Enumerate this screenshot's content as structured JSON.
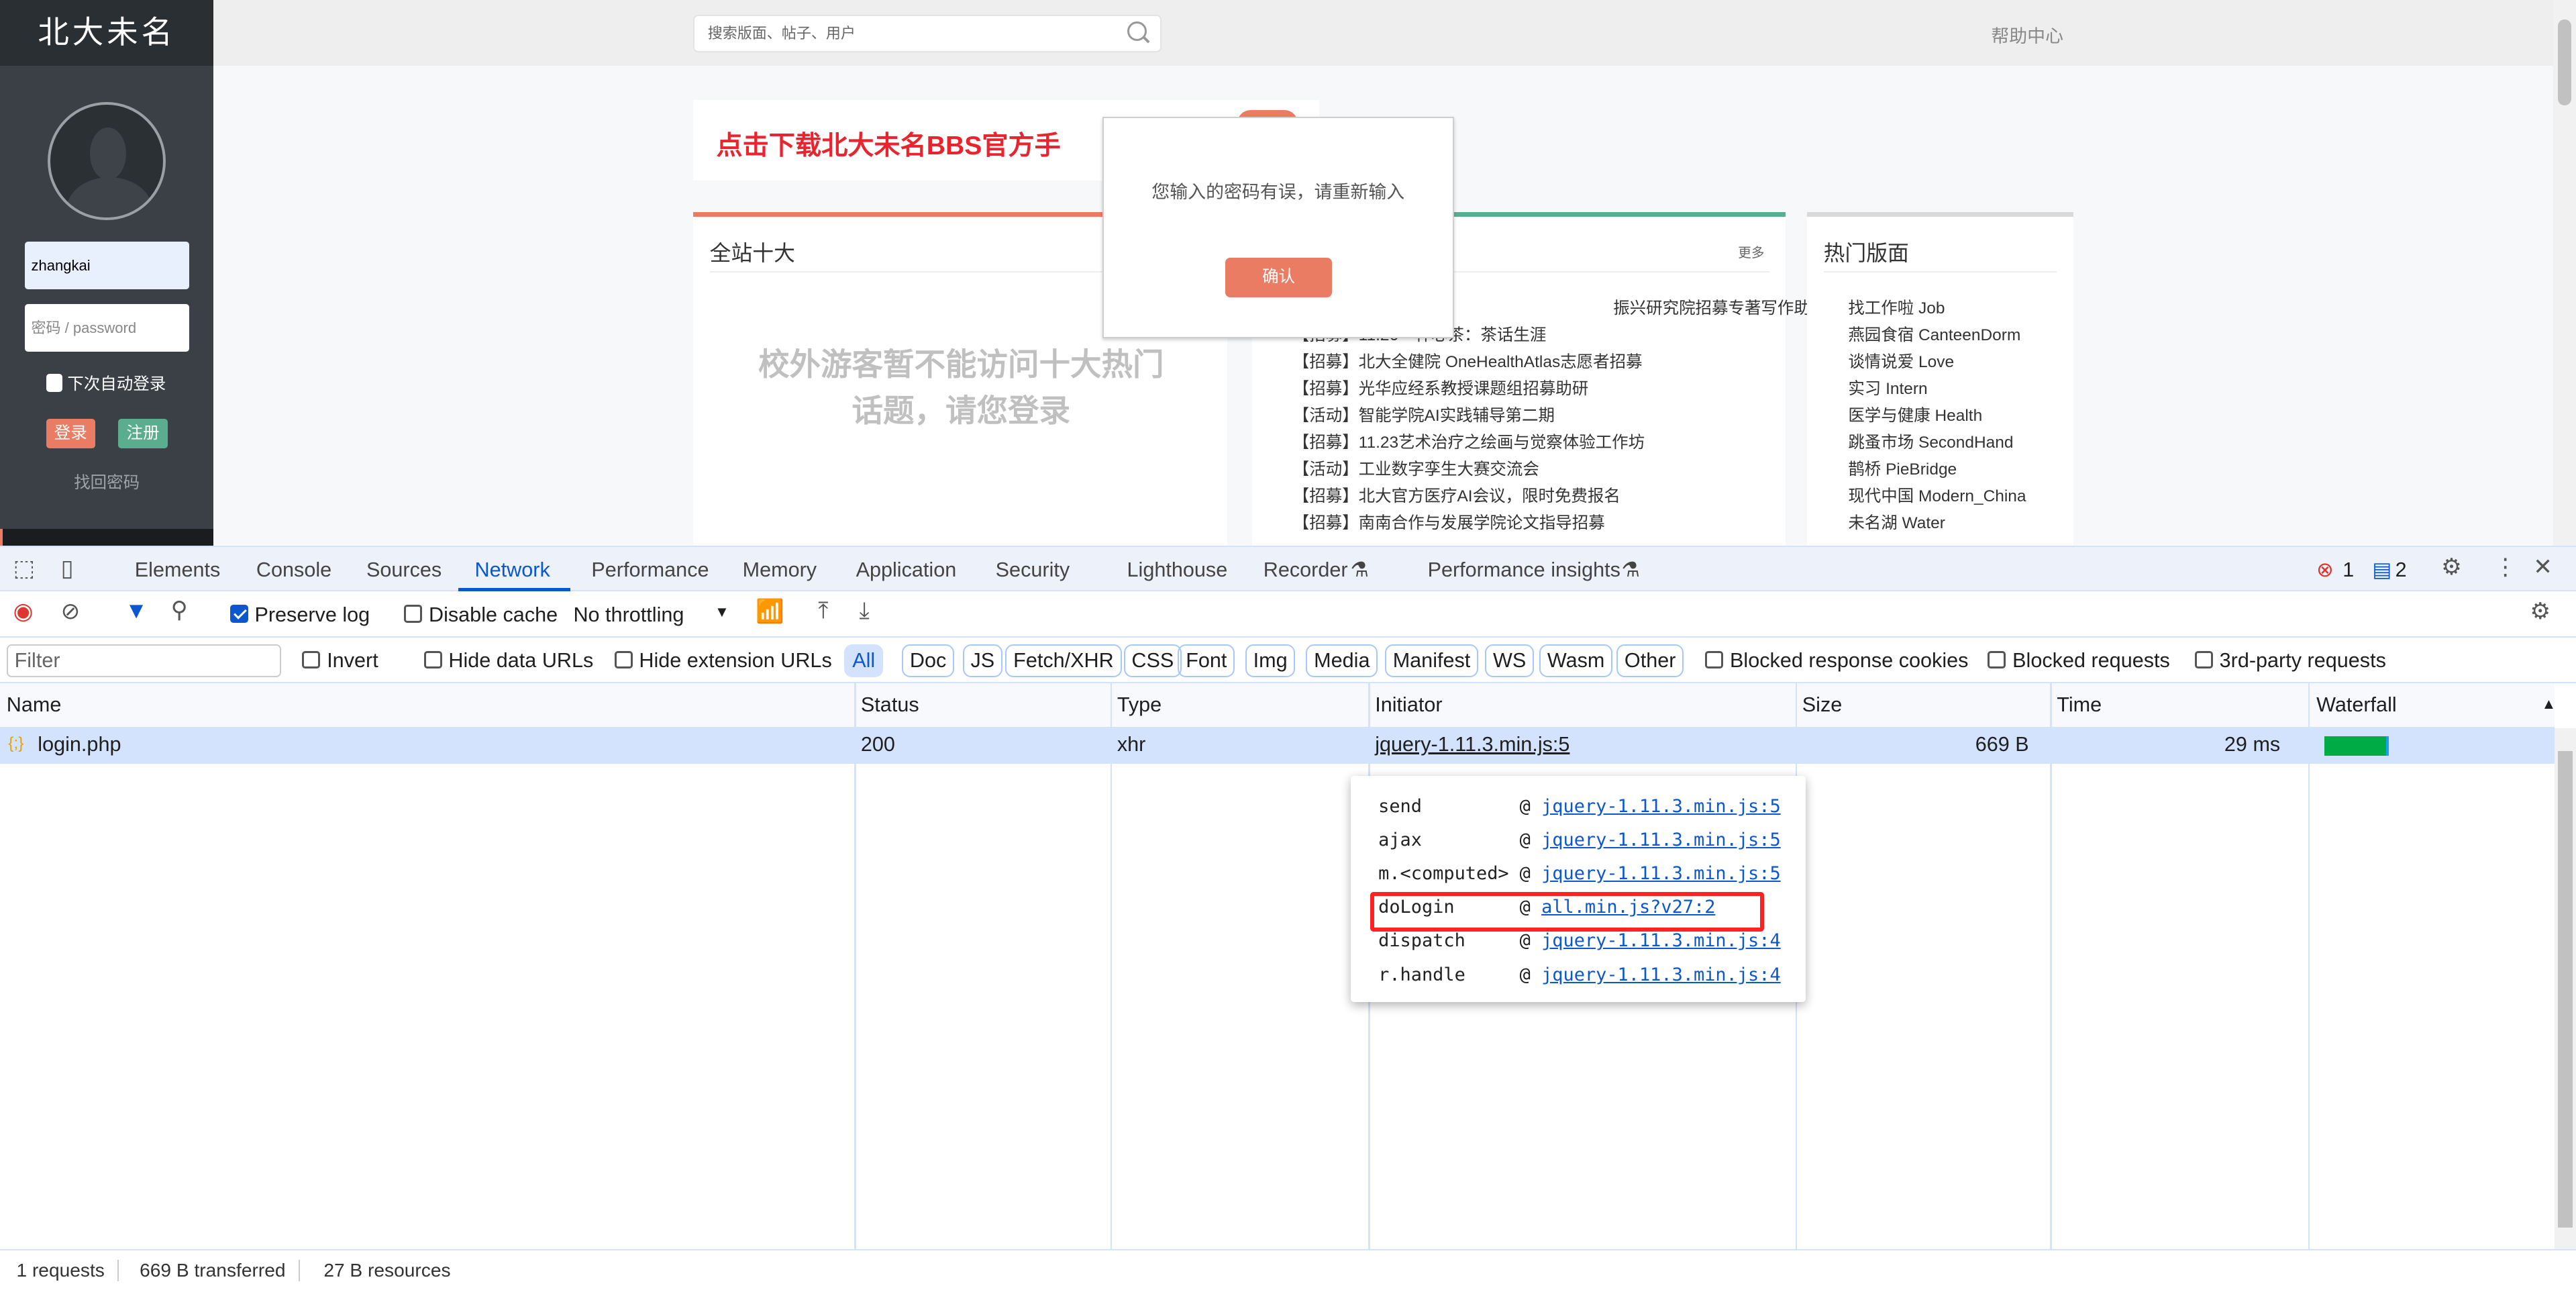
{
  "site": {
    "logo": "北大未名",
    "search_placeholder": "搜索版面、帖子、用户",
    "help": "帮助中心",
    "banner": "点击下载北大未名BBS官方手",
    "login": {
      "username": "zhangkai",
      "password_placeholder": "密码 / password",
      "auto_login": "下次自动登录",
      "login_btn": "登录",
      "register_btn": "注册",
      "forgot": "找回密码"
    },
    "top_ten": {
      "title": "全站十大",
      "guest_msg_1": "校外游客暂不能访问十大热门",
      "guest_msg_2": "话题，请您登录"
    },
    "news": {
      "more": "更多",
      "items": [
        "振兴研究院招募专著写作助研",
        "【招募】11.26一杯心茶：茶话生涯",
        "【招募】北大全健院 OneHealthAtlas志愿者招募",
        "【招募】光华应经系教授课题组招募助研",
        "【活动】智能学院AI实践辅导第二期",
        "【招募】11.23艺术治疗之绘画与觉察体验工作坊",
        "【活动】工业数字孪生大赛交流会",
        "【招募】北大官方医疗AI会议，限时免费报名",
        "【招募】南南合作与发展学院论文指导招募"
      ]
    },
    "hot_boards": {
      "title": "热门版面",
      "items": [
        "找工作啦 Job",
        "燕园食宿 CanteenDorm",
        "谈情说爱 Love",
        "实习 Intern",
        "医学与健康 Health",
        "跳蚤市场 SecondHand",
        "鹊桥 PieBridge",
        "现代中国 Modern_China",
        "未名湖 Water"
      ]
    },
    "dialog": {
      "message": "您输入的密码有误，请重新输入",
      "ok": "确认"
    }
  },
  "devtools": {
    "tabs": [
      "Elements",
      "Console",
      "Sources",
      "Network",
      "Performance",
      "Memory",
      "Application",
      "Security",
      "Lighthouse",
      "Recorder",
      "Performance insights"
    ],
    "active_tab": "Network",
    "errors": "1",
    "messages": "2",
    "toolbar": {
      "preserve_log": "Preserve log",
      "preserve_log_checked": true,
      "disable_cache": "Disable cache",
      "throttling": "No throttling"
    },
    "filter": {
      "placeholder": "Filter",
      "invert": "Invert",
      "hide_data": "Hide data URLs",
      "hide_ext": "Hide extension URLs",
      "types": [
        "All",
        "Doc",
        "JS",
        "Fetch/XHR",
        "CSS",
        "Font",
        "Img",
        "Media",
        "Manifest",
        "WS",
        "Wasm",
        "Other"
      ],
      "blocked_cookies": "Blocked response cookies",
      "blocked_requests": "Blocked requests",
      "third_party": "3rd-party requests"
    },
    "columns": [
      "Name",
      "Status",
      "Type",
      "Initiator",
      "Size",
      "Time",
      "Waterfall"
    ],
    "rows": [
      {
        "name": "login.php",
        "status": "200",
        "type": "xhr",
        "initiator": "jquery-1.11.3.min.js:5",
        "size": "669 B",
        "time": "29 ms"
      }
    ],
    "stack": [
      {
        "fn": "send",
        "src": "jquery-1.11.3.min.js:5"
      },
      {
        "fn": "ajax",
        "src": "jquery-1.11.3.min.js:5"
      },
      {
        "fn": "m.<computed>",
        "src": "jquery-1.11.3.min.js:5"
      },
      {
        "fn": "doLogin",
        "src": "all.min.js?v27:2"
      },
      {
        "fn": "dispatch",
        "src": "jquery-1.11.3.min.js:4"
      },
      {
        "fn": "r.handle",
        "src": "jquery-1.11.3.min.js:4"
      }
    ],
    "highlighted_frame": "doLogin",
    "status": {
      "requests": "1 requests",
      "transferred": "669 B transferred",
      "resources": "27 B resources"
    }
  },
  "colors": {
    "accent": "#ea7c63",
    "green": "#5aad8f",
    "devtools_blue": "#0b57d0",
    "highlight": "#ff2222"
  }
}
